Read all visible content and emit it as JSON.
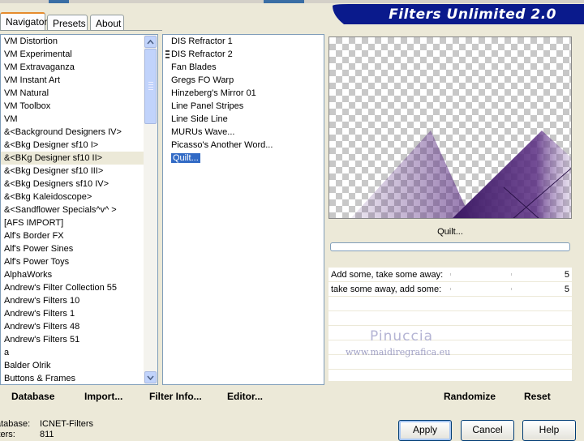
{
  "tabs": [
    {
      "label": "Navigator",
      "active": true
    },
    {
      "label": "Presets",
      "active": false
    },
    {
      "label": "About",
      "active": false
    }
  ],
  "banner": {
    "title": "Filters Unlimited 2.0"
  },
  "categories": [
    "VM Distortion",
    "VM Experimental",
    "VM Extravaganza",
    "VM Instant Art",
    "VM Natural",
    "VM Toolbox",
    "VM",
    "&<Background Designers IV>",
    "&<Bkg Designer sf10 I>",
    "&<BKg Designer sf10 II>",
    "&<Bkg Designer sf10 III>",
    "&<Bkg Designers sf10 IV>",
    "&<Bkg Kaleidoscope>",
    "&<Sandflower Specials^v^ >",
    "[AFS IMPORT]",
    "Alf's Border FX",
    "Alf's Power Sines",
    "Alf's Power Toys",
    "AlphaWorks",
    "Andrew's Filter Collection 55",
    "Andrew's Filters 10",
    "Andrew's Filters 1",
    "Andrew's Filters 48",
    "Andrew's Filters 51",
    "a",
    "Balder Olrik",
    "Buttons & Frames"
  ],
  "selected_category": "&<BKg Designer sf10 II>",
  "filters": [
    "DIS Refractor 1",
    "DIS Refractor 2",
    "Fan Blades",
    "Gregs FO Warp",
    "Hinzeberg's Mirror 01",
    "Line Panel Stripes",
    "Line Side Line",
    "MURUs Wave...",
    "Picasso's Another Word...",
    "Quilt..."
  ],
  "selected_filter": "Quilt...",
  "preview": {
    "filter_name": "Quilt...",
    "progress": 0,
    "accent": "#5a2d82"
  },
  "params": [
    {
      "label": "Add some, take some away:",
      "value": "5"
    },
    {
      "label": "take some away, add some:",
      "value": "5"
    }
  ],
  "watermark": {
    "name": "Pinuccia",
    "url": "www.maidiregrafica.eu"
  },
  "bottom_links": {
    "database": "Database",
    "import": "Import...",
    "filter_info": "Filter Info...",
    "editor": "Editor...",
    "randomize": "Randomize",
    "reset": "Reset"
  },
  "status": {
    "database_label": "atabase:",
    "database_value": "ICNET-Filters",
    "filters_label": "lters:",
    "filters_value": "811"
  },
  "buttons": {
    "apply": "Apply",
    "cancel": "Cancel",
    "help": "Help"
  },
  "colors": {
    "selection": "#316ac5",
    "banner": "#0a1a8c"
  }
}
